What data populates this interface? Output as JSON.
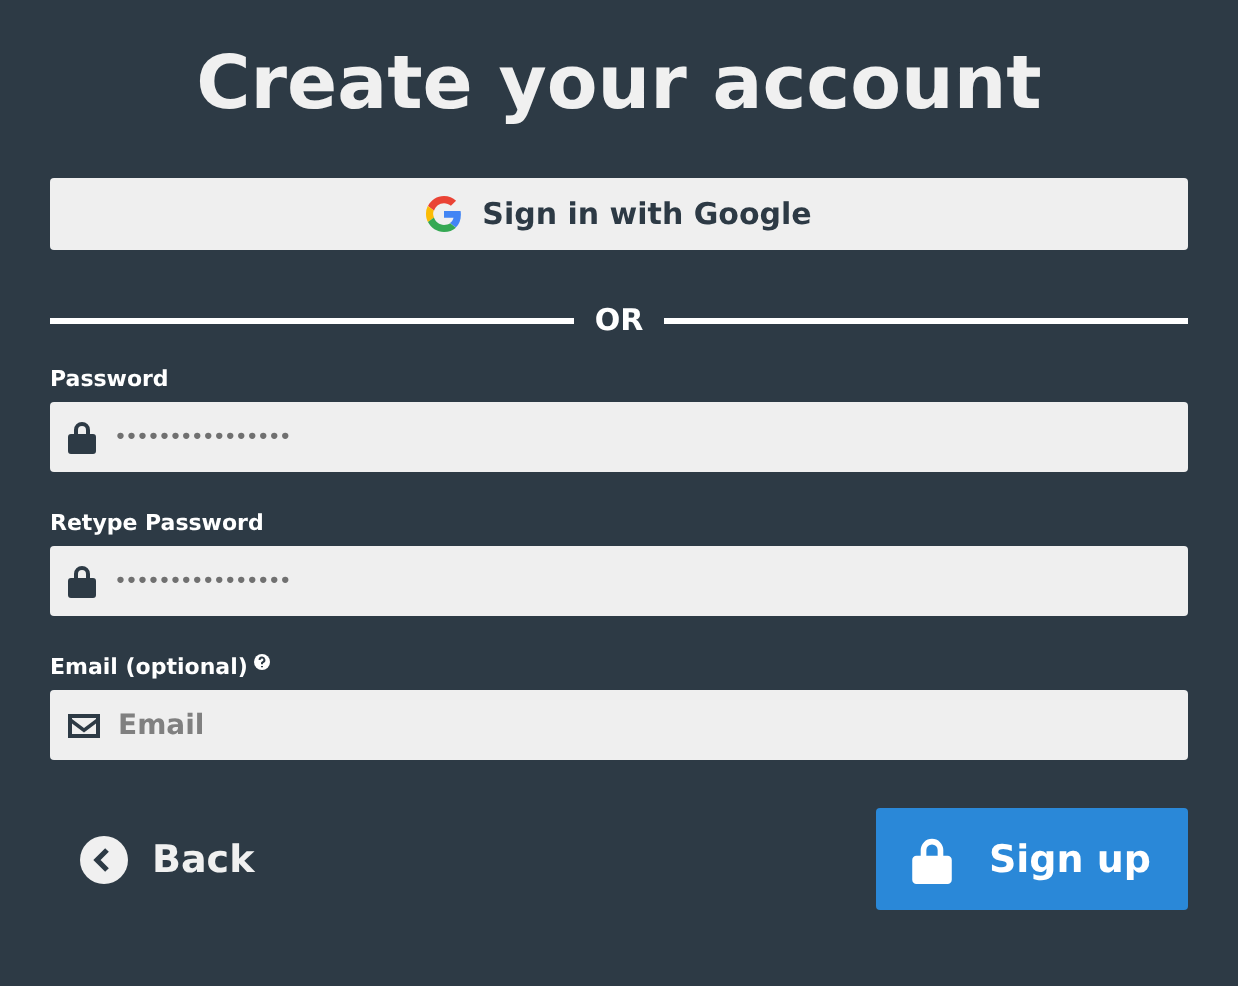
{
  "title": "Create your account",
  "google_button": {
    "label": "Sign in with Google"
  },
  "divider": {
    "label": "OR"
  },
  "fields": [
    {
      "kind": "password",
      "label": "Password",
      "value": "••••••••••••••••",
      "help": false
    },
    {
      "kind": "password",
      "label": "Retype Password",
      "value": "••••••••••••••••",
      "help": false
    },
    {
      "kind": "email",
      "label": "Email (optional)",
      "placeholder": "Email",
      "help": true
    }
  ],
  "back_button": {
    "label": "Back"
  },
  "signup_button": {
    "label": "Sign up"
  }
}
